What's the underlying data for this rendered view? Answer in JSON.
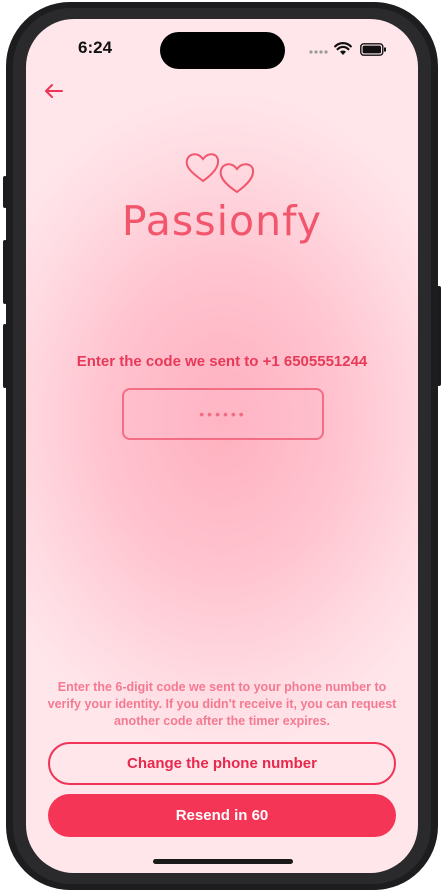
{
  "status": {
    "time": "6:24"
  },
  "header": {
    "back_icon": "arrow-left-icon"
  },
  "brand": {
    "name": "Passionfy",
    "logo_icon": "two-hearts-icon",
    "color": "#f2566d"
  },
  "verification": {
    "prompt": "Enter the code we sent to +1 6505551244",
    "code_value": "••••••",
    "help_text": "Enter the 6-digit code we sent to your phone number to verify your identity. If you didn't receive it, you can request another code after the timer expires."
  },
  "actions": {
    "change_phone_label": "Change the phone number",
    "resend_label": "Resend in 60"
  },
  "colors": {
    "accent": "#f53555",
    "text_accent": "#e83a58"
  }
}
